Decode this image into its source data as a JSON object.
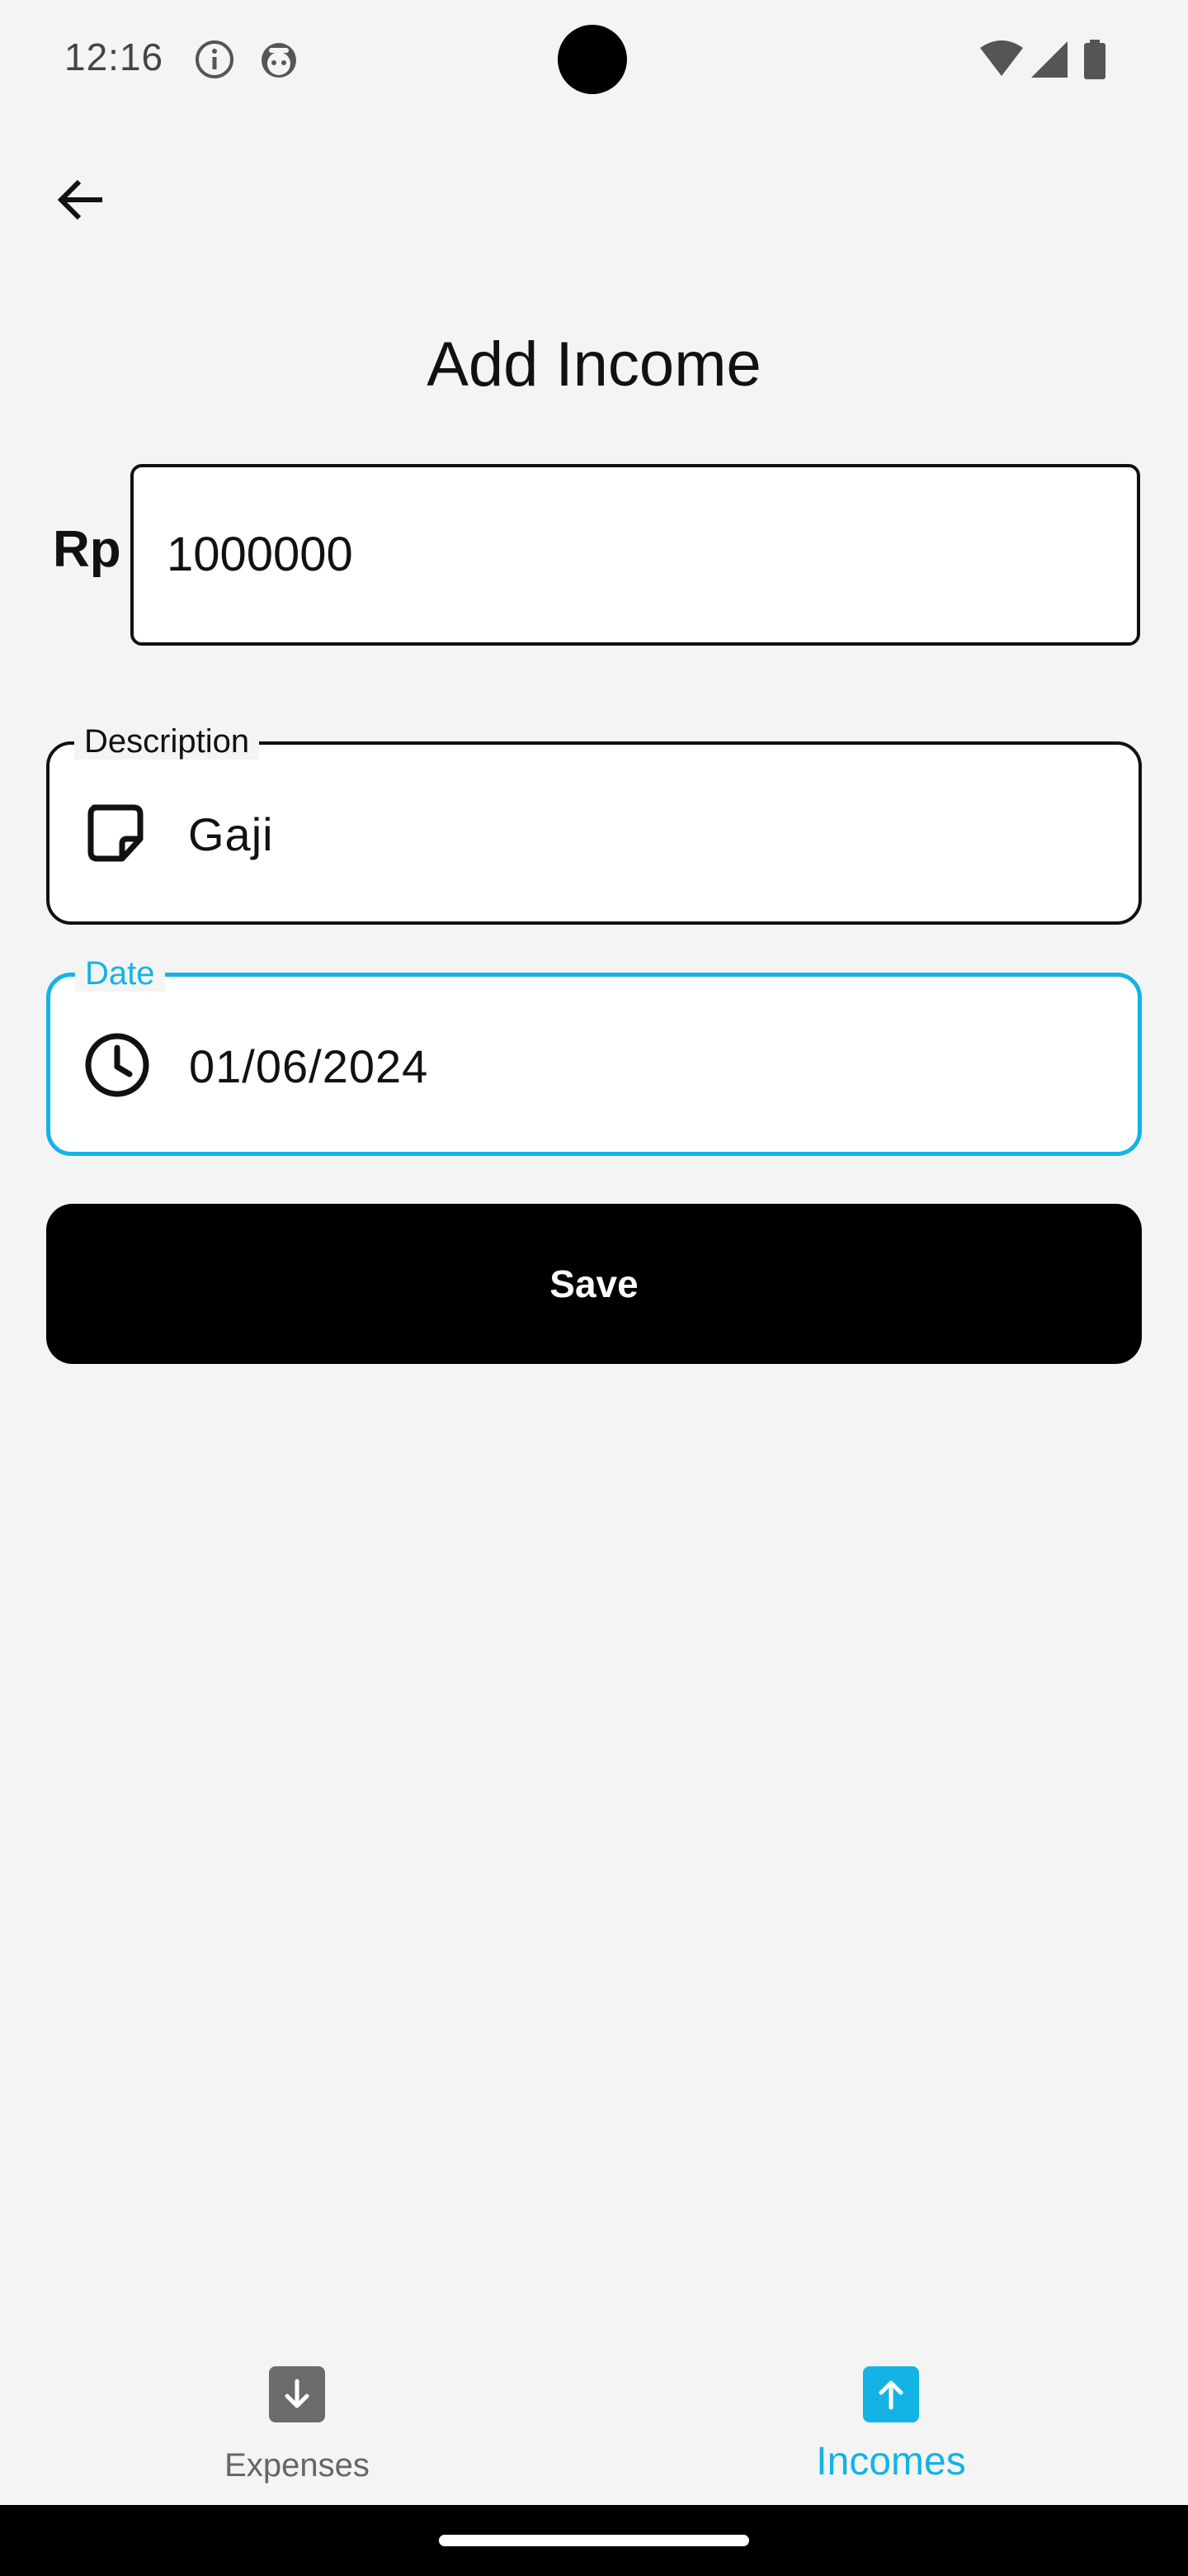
{
  "status_bar": {
    "time": "12:16"
  },
  "header": {
    "title": "Add Income"
  },
  "form": {
    "currency": "Rp",
    "amount": "1000000",
    "description": {
      "label": "Description",
      "value": "Gaji",
      "icon": "sticky-note-icon"
    },
    "date": {
      "label": "Date",
      "value": "01/06/2024",
      "icon": "clock-icon"
    },
    "save_label": "Save"
  },
  "bottom_nav": {
    "items": [
      {
        "label": "Expenses",
        "icon": "arrow-down-icon",
        "active": false
      },
      {
        "label": "Incomes",
        "icon": "arrow-up-icon",
        "active": true
      }
    ]
  },
  "colors": {
    "accent": "#13b4e5",
    "background": "#f4f4f4",
    "inactive": "#6b6b6b"
  }
}
